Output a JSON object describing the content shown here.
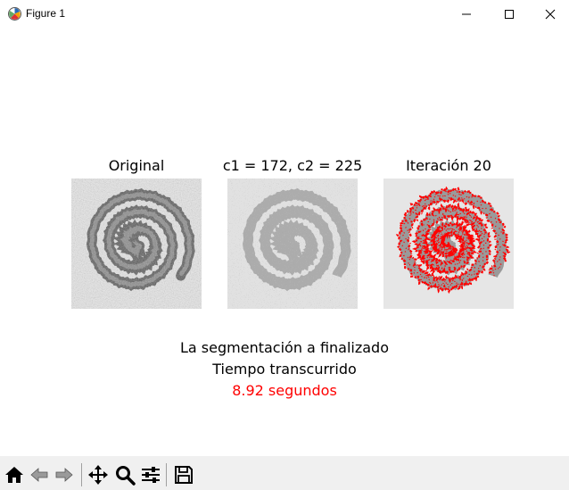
{
  "window": {
    "title": "Figure 1",
    "app_icon": "matplotlib-icon",
    "controls": [
      "minimize-icon",
      "maximize-icon",
      "close-icon"
    ]
  },
  "figure": {
    "panels": [
      {
        "title": "Original",
        "image": "gray-spiral-image"
      },
      {
        "title": "c1 = 172, c2 = 225",
        "image": "two-tone-spiral-image"
      },
      {
        "title": "Iteración 20",
        "image": "spiral-with-red-contour-image"
      }
    ],
    "message": {
      "line1": "La segmentación a finalizado",
      "line2": "Tiempo transcurrido",
      "line3": "8.92 segundos",
      "line3_color": "#ff0000"
    }
  },
  "toolbar": {
    "buttons": [
      {
        "name": "home-icon"
      },
      {
        "name": "back-arrow-icon"
      },
      {
        "name": "forward-arrow-icon"
      },
      {
        "name": "pan-icon"
      },
      {
        "name": "zoom-icon"
      },
      {
        "name": "configure-subplots-icon"
      },
      {
        "name": "save-icon"
      }
    ]
  },
  "colors": {
    "contour": "#ff0000",
    "toolbar_bg": "#f0f0f0"
  }
}
